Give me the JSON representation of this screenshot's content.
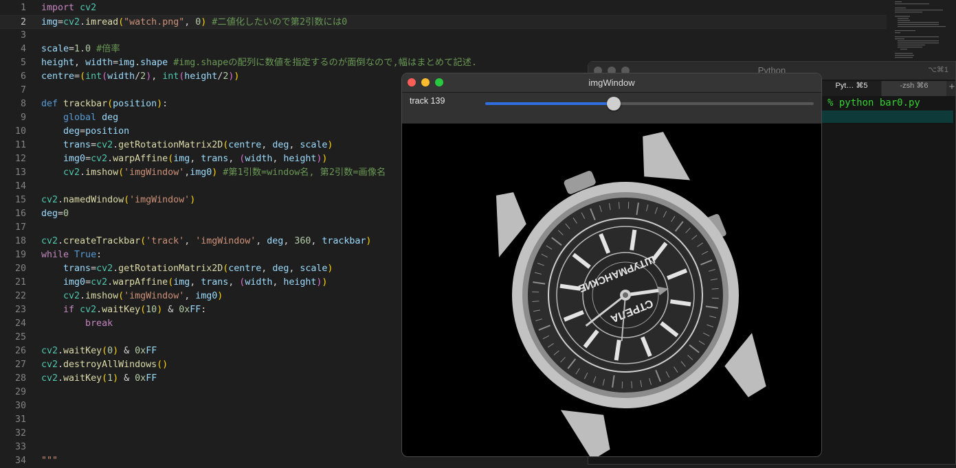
{
  "editor": {
    "current_line": 2,
    "lines": [
      {
        "n": "1",
        "t": [
          [
            "kw",
            "import"
          ],
          [
            "",
            " "
          ],
          [
            "mod",
            "cv2"
          ]
        ]
      },
      {
        "n": "2",
        "t": [
          [
            "var",
            "img"
          ],
          [
            "",
            "="
          ],
          [
            "mod",
            "cv2"
          ],
          [
            "",
            "."
          ],
          [
            "fn",
            "imread"
          ],
          [
            "p1",
            "("
          ],
          [
            "str",
            "\"watch.png\""
          ],
          [
            "",
            ", "
          ],
          [
            "num",
            "0"
          ],
          [
            "p1",
            ")"
          ],
          [
            "",
            "",
            " "
          ],
          [
            "cmt",
            "#二値化したいので第2引数には0"
          ]
        ]
      },
      {
        "n": "3",
        "t": []
      },
      {
        "n": "4",
        "t": [
          [
            "var",
            "scale"
          ],
          [
            "",
            "="
          ],
          [
            "num",
            "1.0"
          ],
          [
            "",
            "",
            " "
          ],
          [
            "cmt",
            "#倍率"
          ]
        ]
      },
      {
        "n": "5",
        "t": [
          [
            "var",
            "height"
          ],
          [
            "",
            ", "
          ],
          [
            "var",
            "width"
          ],
          [
            "",
            "="
          ],
          [
            "var",
            "img"
          ],
          [
            "",
            "."
          ],
          [
            "var",
            "shape"
          ],
          [
            "",
            "",
            " "
          ],
          [
            "cmt",
            "#img.shapeの配列に数値を指定するのが面倒なので,幅はまとめて記述."
          ]
        ]
      },
      {
        "n": "6",
        "t": [
          [
            "var",
            "centre"
          ],
          [
            "",
            "="
          ],
          [
            "p1",
            "("
          ],
          [
            "mod",
            "int"
          ],
          [
            "p2",
            "("
          ],
          [
            "var",
            "width"
          ],
          [
            "",
            "/"
          ],
          [
            "num",
            "2"
          ],
          [
            "p2",
            ")"
          ],
          [
            "",
            ", "
          ],
          [
            "mod",
            "int"
          ],
          [
            "p2",
            "("
          ],
          [
            "var",
            "height"
          ],
          [
            "",
            "/"
          ],
          [
            "num",
            "2"
          ],
          [
            "p2",
            ")"
          ],
          [
            "p1",
            ")"
          ]
        ]
      },
      {
        "n": "7",
        "t": []
      },
      {
        "n": "8",
        "t": [
          [
            "kw2",
            "def"
          ],
          [
            "",
            "",
            " "
          ],
          [
            "fn",
            "trackbar"
          ],
          [
            "p1",
            "("
          ],
          [
            "var",
            "position"
          ],
          [
            "p1",
            ")"
          ],
          [
            "",
            ":"
          ]
        ]
      },
      {
        "n": "9",
        "t": [
          [
            "",
            "    "
          ],
          [
            "kw2",
            "global"
          ],
          [
            "",
            "",
            " "
          ],
          [
            "var",
            "deg"
          ]
        ]
      },
      {
        "n": "10",
        "t": [
          [
            "",
            "    "
          ],
          [
            "var",
            "deg"
          ],
          [
            "",
            "="
          ],
          [
            "var",
            "position"
          ]
        ]
      },
      {
        "n": "11",
        "t": [
          [
            "",
            "    "
          ],
          [
            "var",
            "trans"
          ],
          [
            "",
            "="
          ],
          [
            "mod",
            "cv2"
          ],
          [
            "",
            "."
          ],
          [
            "fn",
            "getRotationMatrix2D"
          ],
          [
            "p1",
            "("
          ],
          [
            "var",
            "centre"
          ],
          [
            "",
            ", "
          ],
          [
            "var",
            "deg"
          ],
          [
            "",
            ", "
          ],
          [
            "var",
            "scale"
          ],
          [
            "p1",
            ")"
          ]
        ]
      },
      {
        "n": "12",
        "t": [
          [
            "",
            "    "
          ],
          [
            "var",
            "img0"
          ],
          [
            "",
            "="
          ],
          [
            "mod",
            "cv2"
          ],
          [
            "",
            "."
          ],
          [
            "fn",
            "warpAffine"
          ],
          [
            "p1",
            "("
          ],
          [
            "var",
            "img"
          ],
          [
            "",
            ", "
          ],
          [
            "var",
            "trans"
          ],
          [
            "",
            ", "
          ],
          [
            "p2",
            "("
          ],
          [
            "var",
            "width"
          ],
          [
            "",
            ", "
          ],
          [
            "var",
            "height"
          ],
          [
            "p2",
            ")"
          ],
          [
            "p1",
            ")"
          ]
        ]
      },
      {
        "n": "13",
        "t": [
          [
            "",
            "    "
          ],
          [
            "mod",
            "cv2"
          ],
          [
            "",
            "."
          ],
          [
            "fn",
            "imshow"
          ],
          [
            "p1",
            "("
          ],
          [
            "str",
            "'imgWindow'"
          ],
          [
            "",
            ","
          ],
          [
            "var",
            "img0"
          ],
          [
            "p1",
            ")"
          ],
          [
            "",
            "",
            " "
          ],
          [
            "cmt",
            "#第1引数=window名, 第2引数=画像名"
          ]
        ]
      },
      {
        "n": "14",
        "t": []
      },
      {
        "n": "15",
        "t": [
          [
            "mod",
            "cv2"
          ],
          [
            "",
            "."
          ],
          [
            "fn",
            "namedWindow"
          ],
          [
            "p1",
            "("
          ],
          [
            "str",
            "'imgWindow'"
          ],
          [
            "p1",
            ")"
          ]
        ]
      },
      {
        "n": "16",
        "t": [
          [
            "var",
            "deg"
          ],
          [
            "",
            "="
          ],
          [
            "num",
            "0"
          ]
        ]
      },
      {
        "n": "17",
        "t": []
      },
      {
        "n": "18",
        "t": [
          [
            "mod",
            "cv2"
          ],
          [
            "",
            "."
          ],
          [
            "fn",
            "createTrackbar"
          ],
          [
            "p1",
            "("
          ],
          [
            "str",
            "'track'"
          ],
          [
            "",
            ", "
          ],
          [
            "str",
            "'imgWindow'"
          ],
          [
            "",
            ", "
          ],
          [
            "var",
            "deg"
          ],
          [
            "",
            ", "
          ],
          [
            "num",
            "360"
          ],
          [
            "",
            ", "
          ],
          [
            "var",
            "trackbar"
          ],
          [
            "p1",
            ")"
          ]
        ]
      },
      {
        "n": "19",
        "t": [
          [
            "kw",
            "while"
          ],
          [
            "",
            "",
            " "
          ],
          [
            "kw2",
            "True"
          ],
          [
            "",
            ":"
          ]
        ]
      },
      {
        "n": "20",
        "t": [
          [
            "",
            "    "
          ],
          [
            "var",
            "trans"
          ],
          [
            "",
            "="
          ],
          [
            "mod",
            "cv2"
          ],
          [
            "",
            "."
          ],
          [
            "fn",
            "getRotationMatrix2D"
          ],
          [
            "p1",
            "("
          ],
          [
            "var",
            "centre"
          ],
          [
            "",
            ", "
          ],
          [
            "var",
            "deg"
          ],
          [
            "",
            ", "
          ],
          [
            "var",
            "scale"
          ],
          [
            "p1",
            ")"
          ]
        ]
      },
      {
        "n": "21",
        "t": [
          [
            "",
            "    "
          ],
          [
            "var",
            "img0"
          ],
          [
            "",
            "="
          ],
          [
            "mod",
            "cv2"
          ],
          [
            "",
            "."
          ],
          [
            "fn",
            "warpAffine"
          ],
          [
            "p1",
            "("
          ],
          [
            "var",
            "img"
          ],
          [
            "",
            ", "
          ],
          [
            "var",
            "trans"
          ],
          [
            "",
            ", "
          ],
          [
            "p2",
            "("
          ],
          [
            "var",
            "width"
          ],
          [
            "",
            ", "
          ],
          [
            "var",
            "height"
          ],
          [
            "p2",
            ")"
          ],
          [
            "p1",
            ")"
          ]
        ]
      },
      {
        "n": "22",
        "t": [
          [
            "",
            "    "
          ],
          [
            "mod",
            "cv2"
          ],
          [
            "",
            "."
          ],
          [
            "fn",
            "imshow"
          ],
          [
            "p1",
            "("
          ],
          [
            "str",
            "'imgWindow'"
          ],
          [
            "",
            ", "
          ],
          [
            "var",
            "img0"
          ],
          [
            "p1",
            ")"
          ]
        ]
      },
      {
        "n": "23",
        "t": [
          [
            "",
            "    "
          ],
          [
            "kw",
            "if"
          ],
          [
            "",
            "",
            " "
          ],
          [
            "mod",
            "cv2"
          ],
          [
            "",
            "."
          ],
          [
            "fn",
            "waitKey"
          ],
          [
            "p1",
            "("
          ],
          [
            "num",
            "10"
          ],
          [
            "p1",
            ")"
          ],
          [
            "",
            "",
            " & "
          ],
          [
            "num",
            "0x"
          ],
          [
            "var",
            "FF"
          ],
          [
            "",
            ":"
          ]
        ]
      },
      {
        "n": "24",
        "t": [
          [
            "",
            "        "
          ],
          [
            "kw",
            "break"
          ]
        ]
      },
      {
        "n": "25",
        "t": []
      },
      {
        "n": "26",
        "t": [
          [
            "mod",
            "cv2"
          ],
          [
            "",
            "."
          ],
          [
            "fn",
            "waitKey"
          ],
          [
            "p1",
            "("
          ],
          [
            "num",
            "0"
          ],
          [
            "p1",
            ")"
          ],
          [
            "",
            "",
            " & "
          ],
          [
            "num",
            "0x"
          ],
          [
            "var",
            "FF"
          ]
        ]
      },
      {
        "n": "27",
        "t": [
          [
            "mod",
            "cv2"
          ],
          [
            "",
            "."
          ],
          [
            "fn",
            "destroyAllWindows"
          ],
          [
            "p1",
            "()"
          ]
        ]
      },
      {
        "n": "28",
        "t": [
          [
            "mod",
            "cv2"
          ],
          [
            "",
            "."
          ],
          [
            "fn",
            "waitKey"
          ],
          [
            "p1",
            "("
          ],
          [
            "num",
            "1"
          ],
          [
            "p1",
            ")"
          ],
          [
            "",
            "",
            " & "
          ],
          [
            "num",
            "0x"
          ],
          [
            "var",
            "FF"
          ]
        ]
      },
      {
        "n": "29",
        "t": []
      },
      {
        "n": "30",
        "t": []
      },
      {
        "n": "31",
        "t": []
      },
      {
        "n": "32",
        "t": []
      },
      {
        "n": "33",
        "t": []
      },
      {
        "n": "34",
        "t": [
          [
            "str",
            "\"\"\""
          ]
        ]
      }
    ]
  },
  "terminal": {
    "title": "Python",
    "shortcut": "⌥⌘1",
    "tabs": [
      {
        "label": "Pyt…  ⌘5",
        "active": true
      },
      {
        "label": "-zsh  ⌘6",
        "active": false
      }
    ],
    "new_tab": "+",
    "prompt": "% python bar0.py"
  },
  "img_window": {
    "title": "imgWindow",
    "trackbar": {
      "name": "track",
      "value": 139,
      "max": 360,
      "label": "track 139"
    },
    "watch_texts": [
      "ШТУРМАНСКИЕ",
      "СТРЕЛА"
    ]
  },
  "colors": {
    "traffic_close": "#ff5f57",
    "traffic_min": "#febc2e",
    "traffic_max": "#28c840",
    "slider_fill": "#2f6fe0",
    "prompt": "#36d134"
  }
}
